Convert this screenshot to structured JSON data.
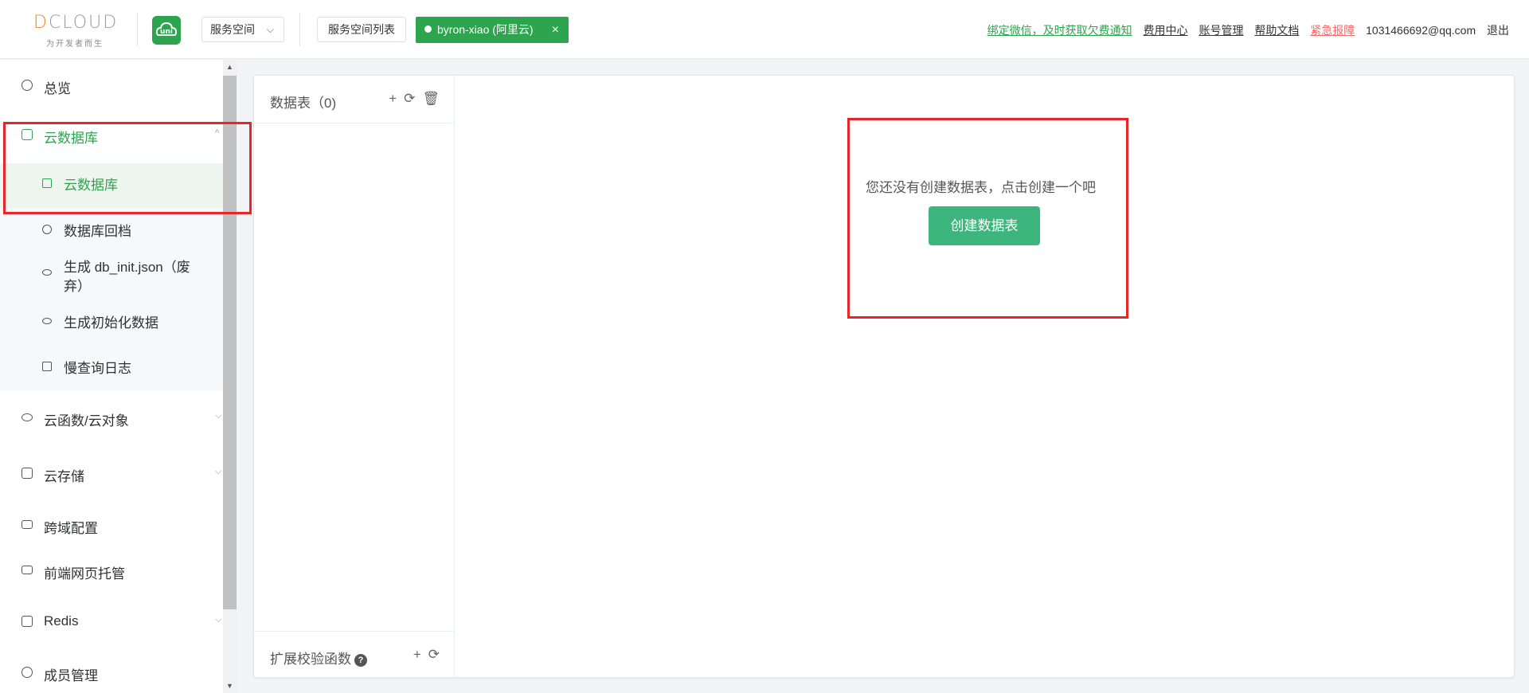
{
  "brand": {
    "logo_word_accent": "D",
    "logo_word_rest": "CLOUD",
    "logo_tagline": "为开发者而生",
    "uni_label": "uni"
  },
  "header": {
    "space_select": "服务空间",
    "space_list_button": "服务空间列表",
    "active_space": "byron-xiao (阿里云)",
    "active_space_close": "×",
    "links": {
      "bind_wechat": "绑定微信，及时获取欠费通知",
      "billing": "费用中心",
      "account": "账号管理",
      "docs": "帮助文档",
      "emergency": "紧急报障",
      "email": "1031466692@qq.com",
      "logout": "退出"
    }
  },
  "sidebar": {
    "overview": "总览",
    "cloud_db": "云数据库",
    "sub": {
      "cloud_db": "云数据库",
      "db_rollback": "数据库回档",
      "gen_db_init": "生成 db_init.json（废弃）",
      "gen_init_data": "生成初始化数据",
      "slow_query_log": "慢查询日志"
    },
    "cloud_functions": "云函数/云对象",
    "cloud_storage": "云存储",
    "cors_config": "跨域配置",
    "web_hosting": "前端网页托管",
    "redis": "Redis",
    "members": "成员管理"
  },
  "main": {
    "tables_title": "数据表（0)",
    "empty_text": "您还没有创建数据表，点击创建一个吧",
    "create_button": "创建数据表",
    "validate_title": "扩展校验函数",
    "help_glyph": "?"
  },
  "icons": {
    "add": "+",
    "refresh": "⟳",
    "delete": "🗑",
    "chevron_down": "⌵",
    "chevron_up": "^"
  },
  "colors": {
    "brand_green": "#2da44e",
    "button_green": "#3db67d",
    "highlight_red": "#e8262a",
    "danger_link": "#f56c6c"
  }
}
